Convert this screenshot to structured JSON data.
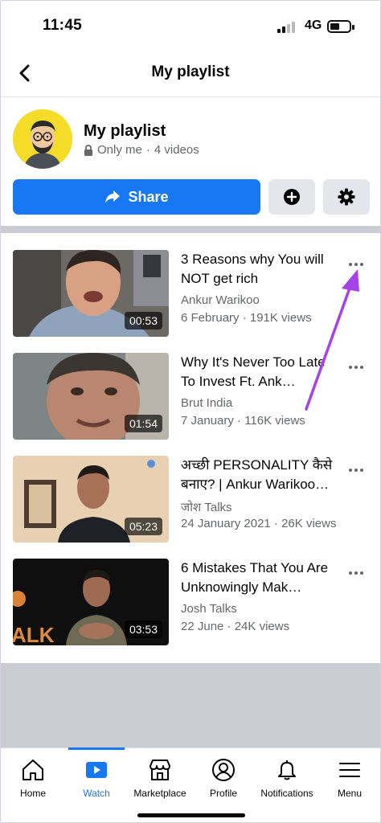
{
  "status_bar": {
    "time": "11:45",
    "network": "4G"
  },
  "header": {
    "title": "My playlist"
  },
  "playlist": {
    "name": "My playlist",
    "privacy": "Only me",
    "separator": "·",
    "video_count": "4 videos"
  },
  "actions": {
    "share_label": "Share"
  },
  "videos": [
    {
      "title": "3 Reasons why You will NOT get rich",
      "channel": "Ankur Warikoo",
      "stats": "6 February · 191K views",
      "duration": "00:53"
    },
    {
      "title": "Why It's Never Too Late To Invest Ft. Ank…",
      "channel": "Brut India",
      "stats": "7 January · 116K views",
      "duration": "01:54"
    },
    {
      "title": "अच्छी PERSONALITY कैसे बनाए? | Ankur Warikoo…",
      "channel": "जोश Talks",
      "stats": "24 January 2021 · 26K views",
      "duration": "05:23"
    },
    {
      "title": "6 Mistakes That You Are Unknowingly Mak…",
      "channel": "Josh Talks",
      "stats": "22 June · 24K views",
      "duration": "03:53"
    }
  ],
  "bottom_nav": {
    "items": [
      {
        "label": "Home",
        "icon": "home-icon"
      },
      {
        "label": "Watch",
        "icon": "watch-icon",
        "active": true
      },
      {
        "label": "Marketplace",
        "icon": "marketplace-icon"
      },
      {
        "label": "Profile",
        "icon": "profile-icon"
      },
      {
        "label": "Notifications",
        "icon": "bell-icon"
      },
      {
        "label": "Menu",
        "icon": "menu-icon"
      }
    ]
  },
  "colors": {
    "accent": "#1877f2",
    "annotation": "#a542e8",
    "secondary_text": "#65676b"
  }
}
